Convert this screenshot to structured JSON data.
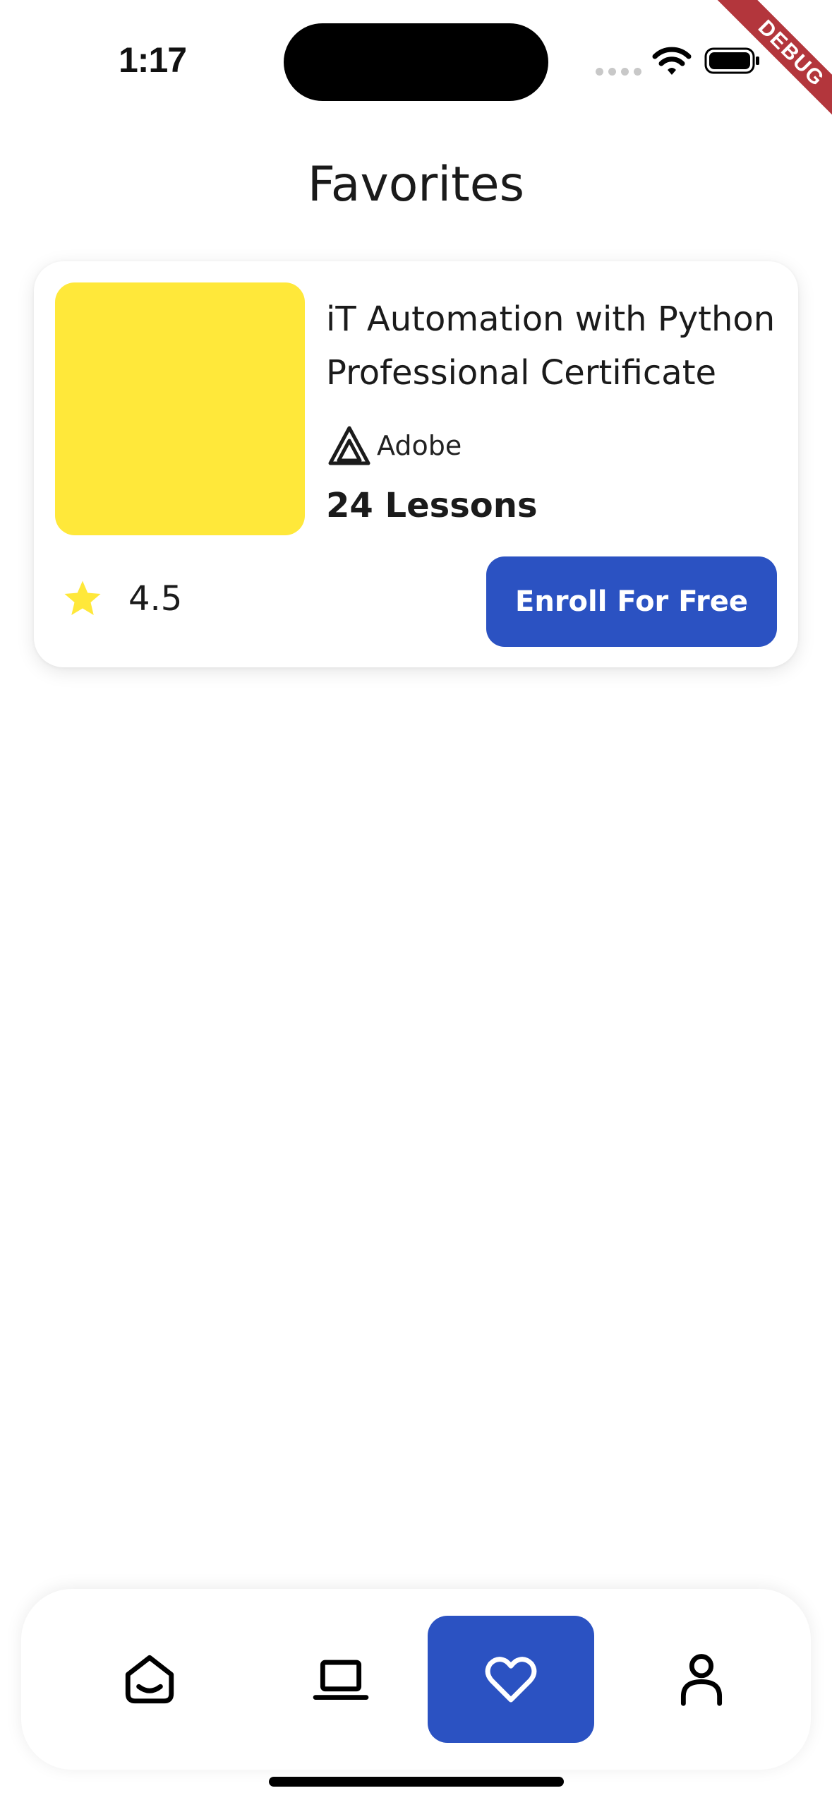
{
  "status_bar": {
    "time": "1:17"
  },
  "debug_banner": "DEBUG",
  "page": {
    "title": "Favorites"
  },
  "favorites": [
    {
      "title": "iT Automation with Python Professional Certificate",
      "provider": "Adobe",
      "provider_icon": "adobe-logo-icon",
      "lessons": "24 Lessons",
      "rating": "4.5",
      "enroll_label": "Enroll For Free",
      "thumbnail_color": "#FFE83A"
    }
  ],
  "bottom_nav": {
    "items": [
      {
        "id": "home",
        "icon": "home-icon",
        "active": false
      },
      {
        "id": "courses",
        "icon": "laptop-icon",
        "active": false
      },
      {
        "id": "favorites",
        "icon": "heart-icon",
        "active": true
      },
      {
        "id": "profile",
        "icon": "person-icon",
        "active": false
      }
    ]
  },
  "colors": {
    "accent": "#2B52C2",
    "star": "#FFE83A",
    "debug_ribbon": "#B3363C",
    "text_primary": "#1B1B1B"
  }
}
